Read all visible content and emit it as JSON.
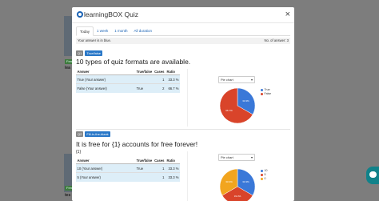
{
  "background": {
    "tag1": "Free",
    "tag2": "Free",
    "text1": "lea",
    "text2": "tes"
  },
  "modal": {
    "title": "learningBOX Quiz",
    "close": "×",
    "tabs": [
      "Today",
      "1 week",
      "1 month",
      "All duration"
    ],
    "info_left": "Your answer is in blue.",
    "info_right": "No. of answer: 3"
  },
  "questions": [
    {
      "num": "Q1",
      "type": "True/false",
      "title": "10 types of quiz formats are available.",
      "sub": "",
      "headers": [
        "Answer",
        "True/false",
        "Cases",
        "Ratio"
      ],
      "rows": [
        {
          "answer": "True (Your answer)",
          "tf": "",
          "cases": "1",
          "ratio": "33.3 %"
        },
        {
          "answer": "False (Your answer)",
          "tf": "True",
          "cases": "2",
          "ratio": "66.7 %"
        }
      ],
      "chart_select": "Pie chart",
      "legend": [
        {
          "label": "True",
          "color": "#3a78d8"
        },
        {
          "label": "False",
          "color": "#d9442a"
        }
      ]
    },
    {
      "num": "Q2",
      "type": "Fill-in-the-blank",
      "title": "It is free for {1} accounts for free forever!",
      "sub": "{1}",
      "headers": [
        "Answer",
        "True/false",
        "Cases",
        "Ratio"
      ],
      "rows": [
        {
          "answer": "10 (Your answer)",
          "tf": "True",
          "cases": "1",
          "ratio": "33.3 %"
        },
        {
          "answer": "5 (Your answer)",
          "tf": "",
          "cases": "1",
          "ratio": "33.3 %"
        }
      ],
      "chart_select": "Pie chart",
      "legend": [
        {
          "label": "10",
          "color": "#3a78d8"
        },
        {
          "label": "5",
          "color": "#d9442a"
        },
        {
          "label": "0",
          "color": "#f2a51f"
        }
      ]
    }
  ],
  "chart_data": [
    {
      "type": "pie",
      "categories": [
        "True",
        "False"
      ],
      "values": [
        33.3,
        66.7
      ],
      "labels": [
        "33.3%",
        "66.7%"
      ],
      "colors": [
        "#3a78d8",
        "#d9442a"
      ],
      "legend": "right"
    },
    {
      "type": "pie",
      "categories": [
        "10",
        "5",
        "0"
      ],
      "values": [
        33.3,
        33.3,
        33.3
      ],
      "labels": [
        "33.3%",
        "33.3%",
        "33.3%"
      ],
      "colors": [
        "#3a78d8",
        "#d9442a",
        "#f2a51f"
      ],
      "legend": "right"
    }
  ]
}
